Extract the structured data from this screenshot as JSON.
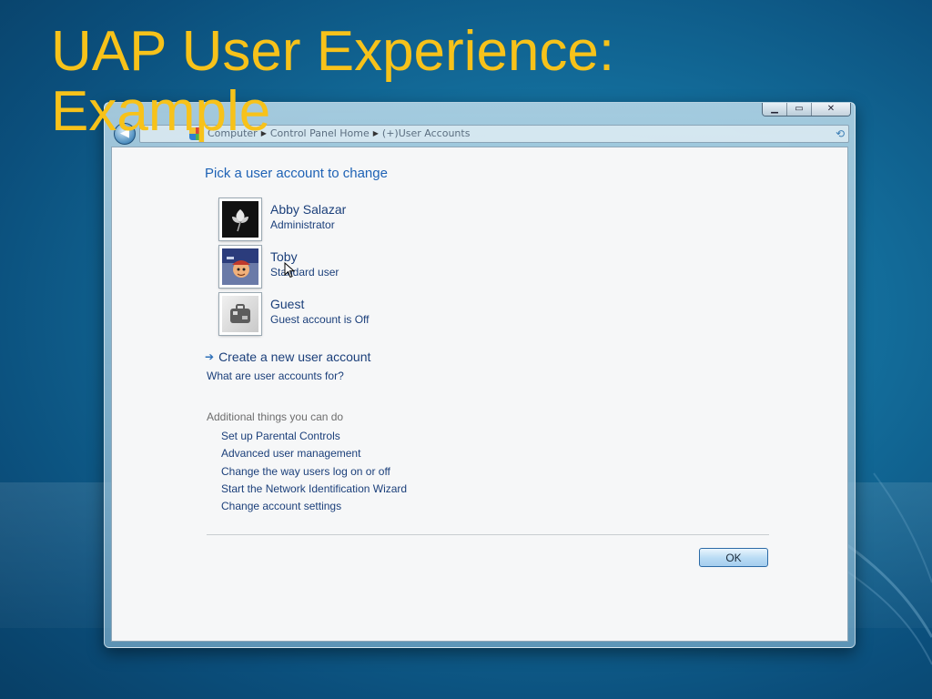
{
  "slide": {
    "title_line1": "UAP User Experience:",
    "title_line2": "Example",
    "title_color": "#f7c21a"
  },
  "window": {
    "controls": {
      "minimize": "▁",
      "maximize": "▭",
      "close": "✕"
    },
    "breadcrumbs": [
      "Computer",
      "Control Panel Home",
      "(+)User Accounts"
    ],
    "icons": [
      "back-arrow-icon",
      "control-panel-icon",
      "refresh-icon"
    ]
  },
  "main": {
    "heading": "Pick a user account to change",
    "accounts": [
      {
        "name": "Abby Salazar",
        "type": "Administrator",
        "icon": "flower-avatar-icon"
      },
      {
        "name": "Toby",
        "type": "Standard user",
        "icon": "cartoon-avatar-icon"
      },
      {
        "name": "Guest",
        "type": "Guest account is Off",
        "icon": "suitcase-avatar-icon"
      }
    ],
    "create_account": "Create a new user account",
    "what_are": "What are user accounts for?",
    "additional_heading": "Additional things you can do",
    "tasks": [
      "Set up Parental Controls",
      "Advanced user management",
      "Change the way users log on or off",
      "Start the Network Identification Wizard",
      "Change account settings"
    ],
    "ok_label": "OK"
  },
  "colors": {
    "link": "#1b3f7a",
    "heading": "#1e62b5",
    "background": "#136d9b"
  }
}
